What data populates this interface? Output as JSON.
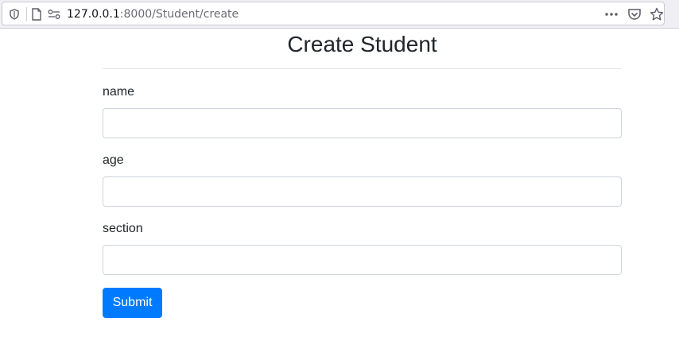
{
  "browser": {
    "url_host": "127.0.0.1",
    "url_path": ":8000/Student/create"
  },
  "page": {
    "title": "Create Student"
  },
  "form": {
    "fields": [
      {
        "label": "name",
        "value": "",
        "placeholder": ""
      },
      {
        "label": "age",
        "value": "",
        "placeholder": ""
      },
      {
        "label": "section",
        "value": "",
        "placeholder": ""
      }
    ],
    "submit_label": "Submit"
  },
  "colors": {
    "primary": "#007bff",
    "text": "#212529",
    "input_border": "#ced4da"
  }
}
